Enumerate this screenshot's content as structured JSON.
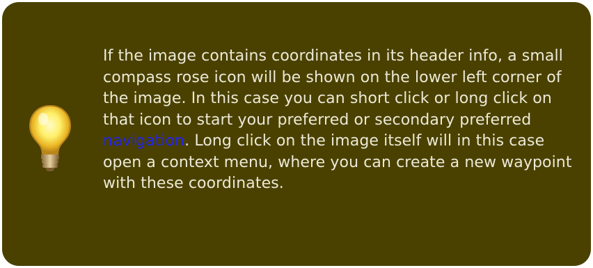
{
  "tip": {
    "icon": "lightbulb-icon",
    "text_before_link": "If the image contains coordinates in its header info, a small compass rose icon will be shown on the lower left corner of the image. In this case you can short click or long click on that icon to start your preferred or secondary preferred ",
    "link_label": "navigation",
    "text_after_link": ". Long click on the image itself will in this case open a context menu, where you can create a new waypoint with these coordinates."
  },
  "colors": {
    "box_background": "#4a4100",
    "text": "#ece9d6",
    "link": "#2222ee"
  }
}
